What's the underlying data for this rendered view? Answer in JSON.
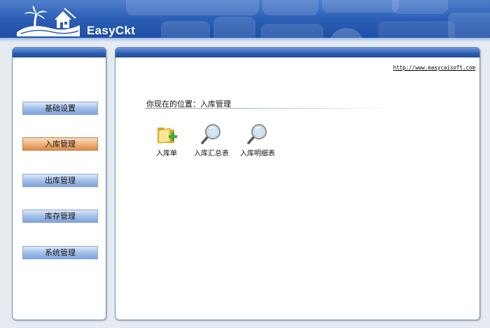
{
  "header": {
    "brand": "EasyCkt",
    "logo_icon": "island-house-logo-icon"
  },
  "sidebar": {
    "items": [
      {
        "label": "基础设置",
        "active": false
      },
      {
        "label": "入库管理",
        "active": true
      },
      {
        "label": "出库管理",
        "active": false
      },
      {
        "label": "库存管理",
        "active": false
      },
      {
        "label": "系统管理",
        "active": false
      }
    ]
  },
  "main": {
    "url": "http://www.easycaisoft.com",
    "location_prefix": "你现在的位置：",
    "location_current": "入库管理",
    "tools": [
      {
        "label": "入库单",
        "icon": "folder-add-icon"
      },
      {
        "label": "入库汇总表",
        "icon": "magnifier-icon"
      },
      {
        "label": "入库明细表",
        "icon": "magnifier-icon"
      }
    ]
  },
  "colors": {
    "header_blue": "#2b5fb6",
    "nav_blue": "#a9c3ea",
    "nav_active_orange": "#efb27a",
    "panel_border": "#6e8fbf"
  }
}
